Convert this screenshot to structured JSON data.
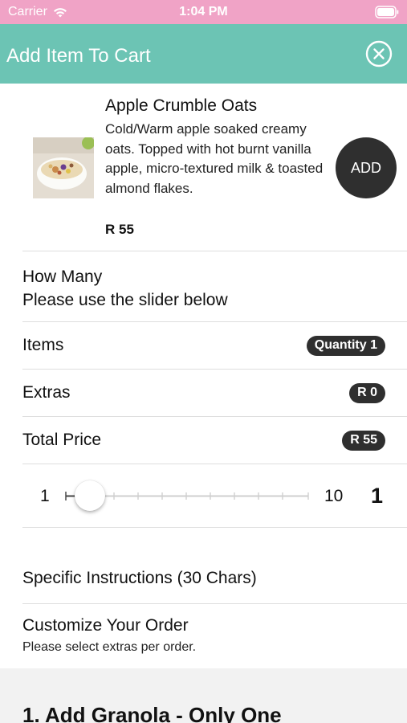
{
  "status_bar": {
    "carrier": "Carrier",
    "time": "1:04 PM"
  },
  "header": {
    "title": "Add Item To Cart",
    "close_icon": "close-circle-icon"
  },
  "product": {
    "name": "Apple Crumble Oats",
    "description": "Cold/Warm apple soaked creamy oats. Topped with hot burnt vanilla apple, micro-textured milk & toasted almond flakes.",
    "price": "R 55",
    "add_label": "ADD"
  },
  "how_many": {
    "title": "How Many",
    "subtitle": "Please use the slider below"
  },
  "summary": {
    "items_label": "Items",
    "items_value": "Quantity 1",
    "extras_label": "Extras",
    "extras_value": "R 0",
    "total_label": "Total Price",
    "total_value": "R 55"
  },
  "slider": {
    "min": "1",
    "max": "10",
    "value": "1",
    "fraction": 0
  },
  "instructions": {
    "label": "Specific Instructions (30 Chars)"
  },
  "customize": {
    "title": "Customize Your Order",
    "subtitle": "Please select extras per order."
  },
  "extras_group": {
    "heading": "1. Add Granola - Only One"
  },
  "colors": {
    "status_bar": "#f0a3c6",
    "header": "#6cc4b4",
    "dark": "#2f2f2f"
  }
}
